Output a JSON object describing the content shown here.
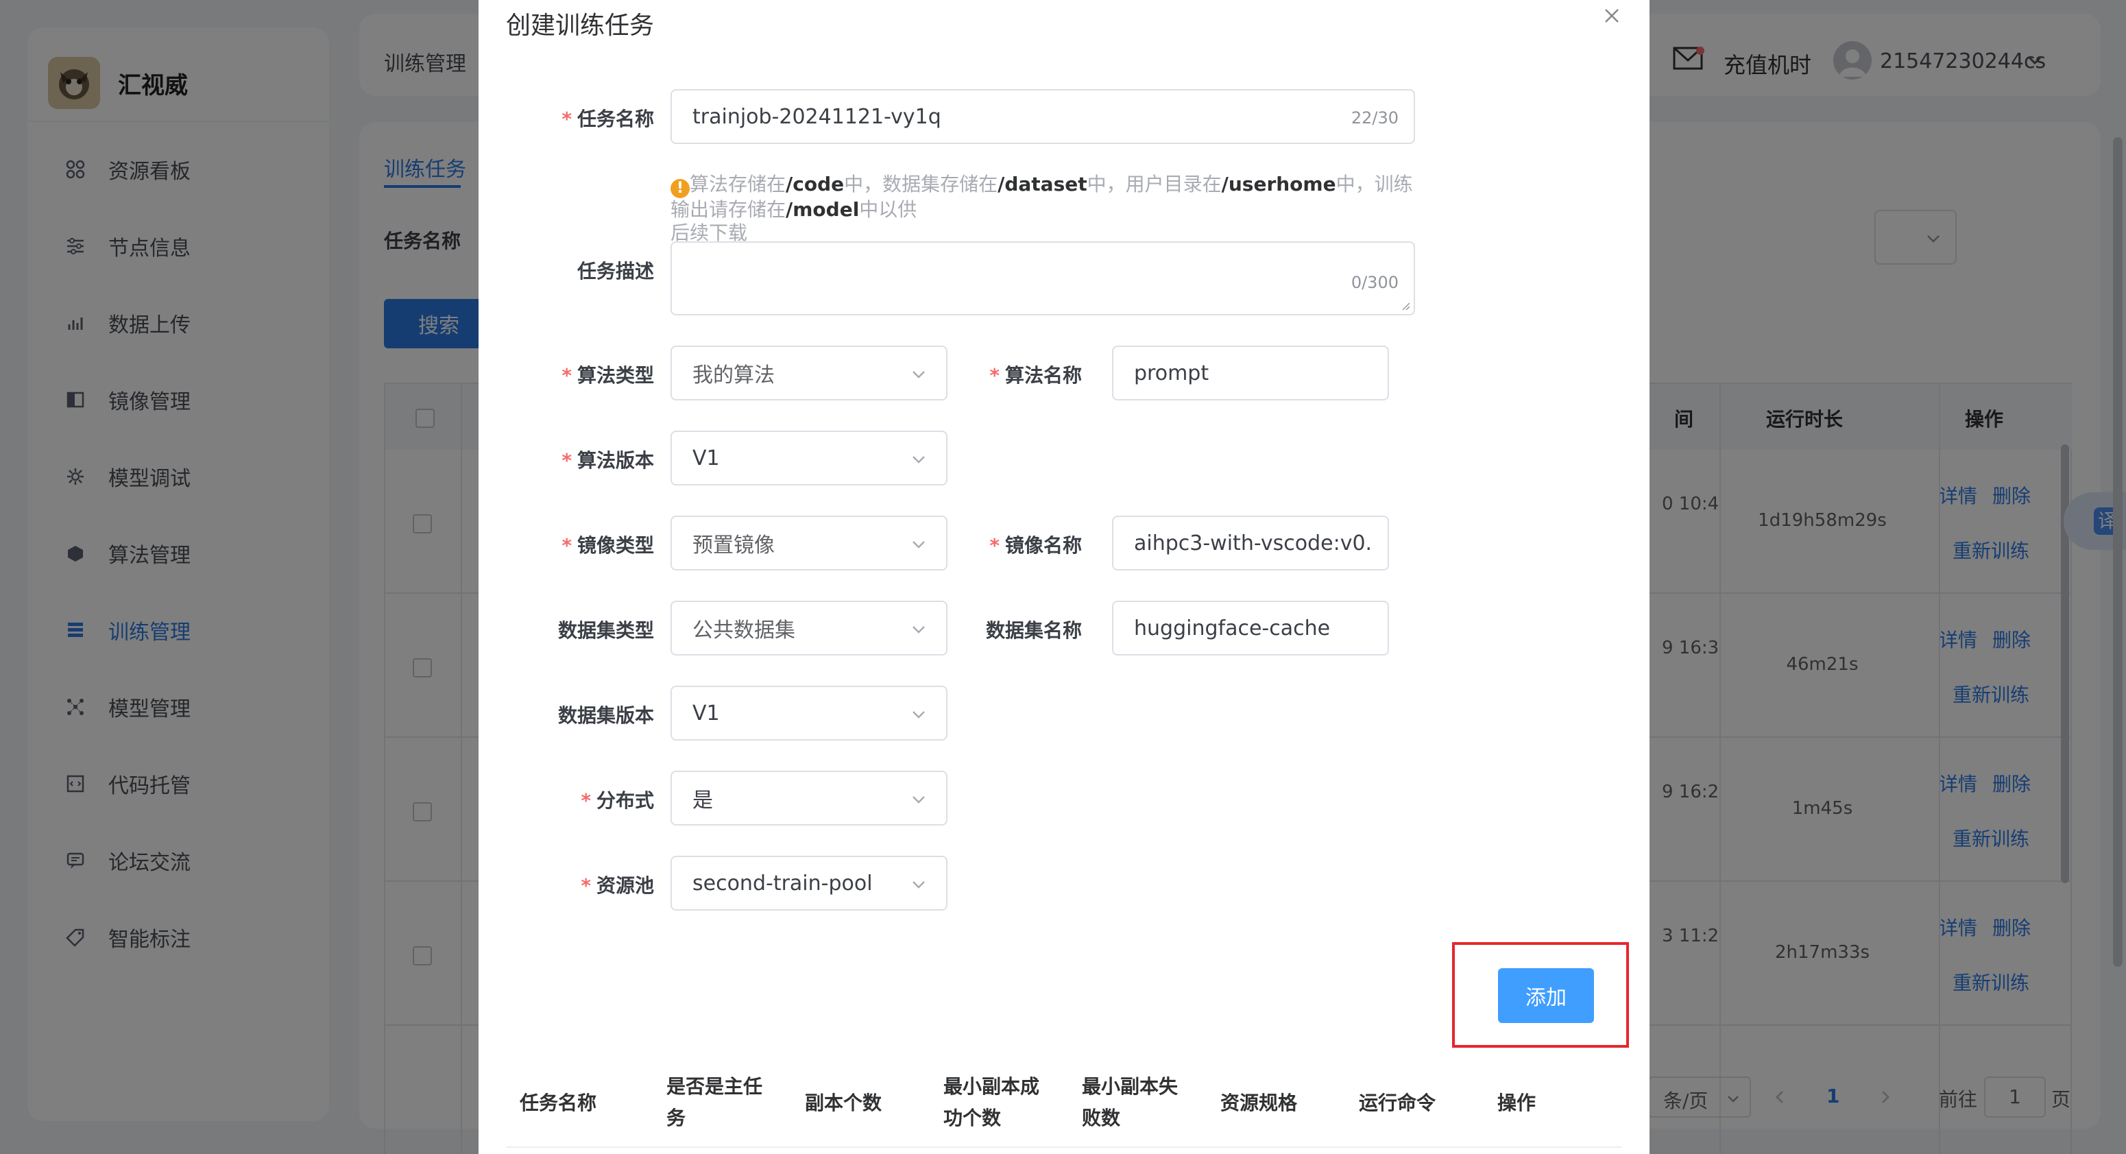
{
  "sidebar": {
    "logo_text": "汇视威",
    "items": [
      {
        "label": "资源看板",
        "icon": "grid-icon"
      },
      {
        "label": "节点信息",
        "icon": "sliders-icon"
      },
      {
        "label": "数据上传",
        "icon": "bar-chart-icon"
      },
      {
        "label": "镜像管理",
        "icon": "book-icon"
      },
      {
        "label": "模型调试",
        "icon": "gear-icon"
      },
      {
        "label": "算法管理",
        "icon": "cube-icon"
      },
      {
        "label": "训练管理",
        "icon": "list-icon"
      },
      {
        "label": "模型管理",
        "icon": "network-icon"
      },
      {
        "label": "代码托管",
        "icon": "code-icon"
      },
      {
        "label": "论坛交流",
        "icon": "chat-icon"
      },
      {
        "label": "智能标注",
        "icon": "tag-icon"
      }
    ]
  },
  "header": {
    "breadcrumb": "训练管理",
    "recharge_label": "充值机时",
    "username": "21547230244cs"
  },
  "background": {
    "tab": "训练任务",
    "filter_label": "任务名称",
    "search_button": "搜索",
    "columns": {
      "time_partial": "间",
      "duration": "运行时长",
      "actions": "操作"
    },
    "rows": [
      {
        "time": "0 10:4",
        "duration": "1d19h58m29s"
      },
      {
        "time": "9 16:3",
        "duration": "46m21s"
      },
      {
        "time": "9 16:2",
        "duration": "1m45s"
      },
      {
        "time": "3 11:2",
        "duration": "2h17m33s"
      }
    ],
    "row_actions": {
      "detail": "详情",
      "delete": "删除",
      "retrain": "重新训练"
    },
    "pagination": {
      "page_size": "条/页",
      "current_page": "1",
      "goto_prefix": "前往",
      "goto_value": "1",
      "goto_suffix": "页"
    },
    "translate_label": "译"
  },
  "modal": {
    "title": "创建训练任务",
    "fields": {
      "task_name": {
        "label": "任务名称",
        "value": "trainjob-20241121-vy1q",
        "count": "22/30"
      },
      "hint": {
        "parts": [
          "算法存储在",
          "/code",
          "中，数据集存储在",
          "/dataset",
          "中，用户目录在",
          "/userhome",
          "中，训练输出请存储在",
          "/model",
          "中以供"
        ],
        "line2": "后续下载"
      },
      "task_desc": {
        "label": "任务描述",
        "value": "",
        "count": "0/300"
      },
      "algo_type": {
        "label": "算法类型",
        "value": "我的算法"
      },
      "algo_name": {
        "label": "算法名称",
        "value": "prompt"
      },
      "algo_version": {
        "label": "算法版本",
        "value": "V1"
      },
      "image_type": {
        "label": "镜像类型",
        "value": "预置镜像"
      },
      "image_name": {
        "label": "镜像名称",
        "value": "aihpc3-with-vscode:v0."
      },
      "dataset_type": {
        "label": "数据集类型",
        "value": "公共数据集"
      },
      "dataset_name": {
        "label": "数据集名称",
        "value": "huggingface-cache"
      },
      "dataset_version": {
        "label": "数据集版本",
        "value": "V1"
      },
      "distributed": {
        "label": "分布式",
        "value": "是"
      },
      "resource_pool": {
        "label": "资源池",
        "value": "second-train-pool"
      }
    },
    "add_button": "添加",
    "table_columns": {
      "task_name": "任务名称",
      "is_main_1": "是否是主任",
      "is_main_2": "务",
      "replicas": "副本个数",
      "min_success_1": "最小副本成",
      "min_success_2": "功个数",
      "min_fail_1": "最小副本失",
      "min_fail_2": "败数",
      "resource_spec": "资源规格",
      "command": "运行命令",
      "action": "操作"
    }
  }
}
